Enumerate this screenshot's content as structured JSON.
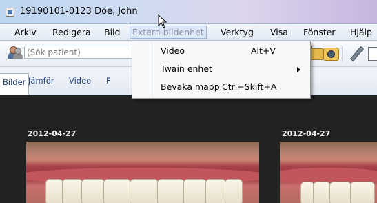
{
  "window": {
    "title": "19190101-0123 Doe, John"
  },
  "menubar": {
    "items": [
      {
        "label": "Arkiv"
      },
      {
        "label": "Redigera"
      },
      {
        "label": "Bild"
      },
      {
        "label": "Extern bildenhet"
      },
      {
        "label": "Verktyg"
      },
      {
        "label": "Visa"
      },
      {
        "label": "Fönster"
      },
      {
        "label": "Hjälp"
      }
    ],
    "active_item": "Extern bildenhet"
  },
  "toolbar": {
    "search_placeholder": "(Sök patient)",
    "icons": [
      "patient-icon",
      "folder-icon",
      "camera-icon",
      "pen-icon",
      "document-icon"
    ]
  },
  "tabs": [
    {
      "label": "Bilder",
      "selected": true
    },
    {
      "label": "Jämför"
    },
    {
      "label": "Video"
    },
    {
      "label": "F"
    }
  ],
  "dropdown": {
    "items": [
      {
        "label": "Video",
        "shortcut": "Alt+V"
      },
      {
        "label": "Twain enhet",
        "shortcut": "",
        "submenu": true
      },
      {
        "label": "Bevaka mapp",
        "shortcut": "Ctrl+Skift+A"
      }
    ]
  },
  "images": [
    {
      "date": "2012-04-27"
    },
    {
      "date": "2012-04-27"
    }
  ],
  "colors": {
    "menu_active_bg": "#dbe7f6",
    "tab_text": "#1f3f79",
    "content_bg": "#222222",
    "date_text": "#f0f0f0"
  }
}
